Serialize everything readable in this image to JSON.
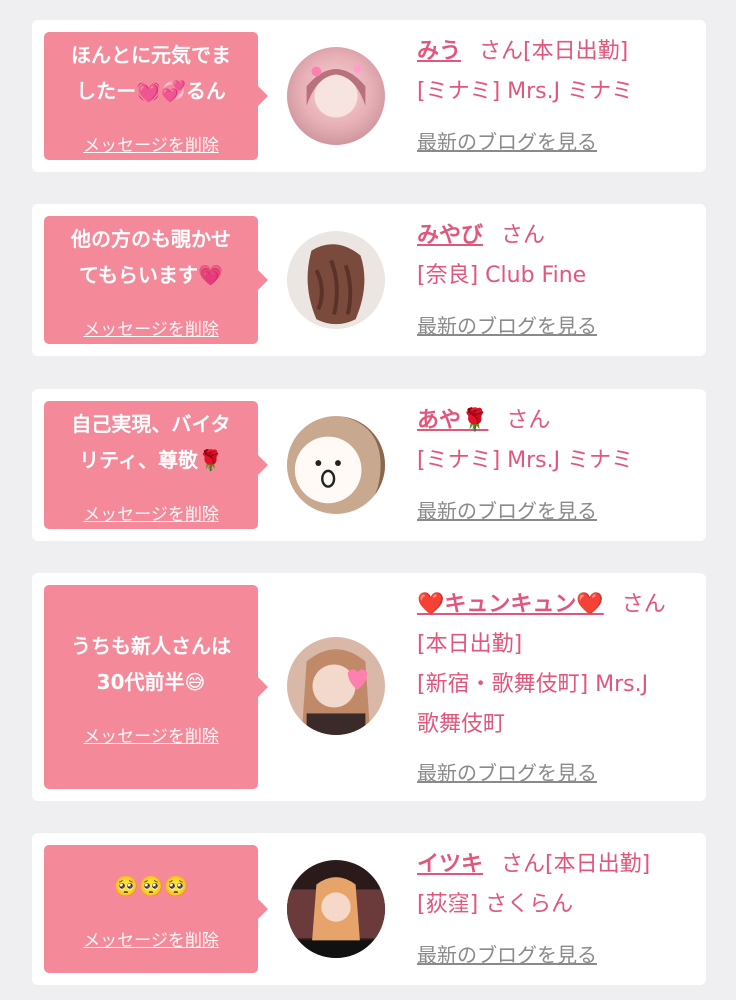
{
  "delete_label": "メッセージを削除",
  "blog_label": "最新のブログを見る",
  "honorific": "さん",
  "colors": {
    "bubble": "#f4899a",
    "accent": "#e1567a",
    "link_gray": "#8a8a8a",
    "background": "#efeff1"
  },
  "cards": [
    {
      "message_lines": [
        "ほんとに元気でま",
        "したー💓💞るん"
      ],
      "name": "みう",
      "status": "[本日出勤]",
      "shop": "[ミナミ] Mrs.J ミナミ"
    },
    {
      "message_lines": [
        "他の方のも覗かせ",
        "てもらいます💗"
      ],
      "name": "みやび",
      "status": "",
      "shop": "[奈良] Club Fine"
    },
    {
      "message_lines": [
        "自己実現、バイタ",
        "リティ、尊敬🌹"
      ],
      "name": "あや🌹",
      "status": "",
      "shop": "[ミナミ] Mrs.J ミナミ"
    },
    {
      "message_lines": [
        "うちも新人さんは",
        "30代前半😅"
      ],
      "name": "❤️キュンキュン❤️",
      "status": "[本日出勤]",
      "shop_line1": "[新宿・歌舞伎町] Mrs.J",
      "shop_line2": "歌舞伎町"
    },
    {
      "message_lines": [
        "🥺🥺🥺"
      ],
      "name": "イツキ",
      "status": "[本日出勤]",
      "shop": "[荻窪] さくらん"
    }
  ]
}
